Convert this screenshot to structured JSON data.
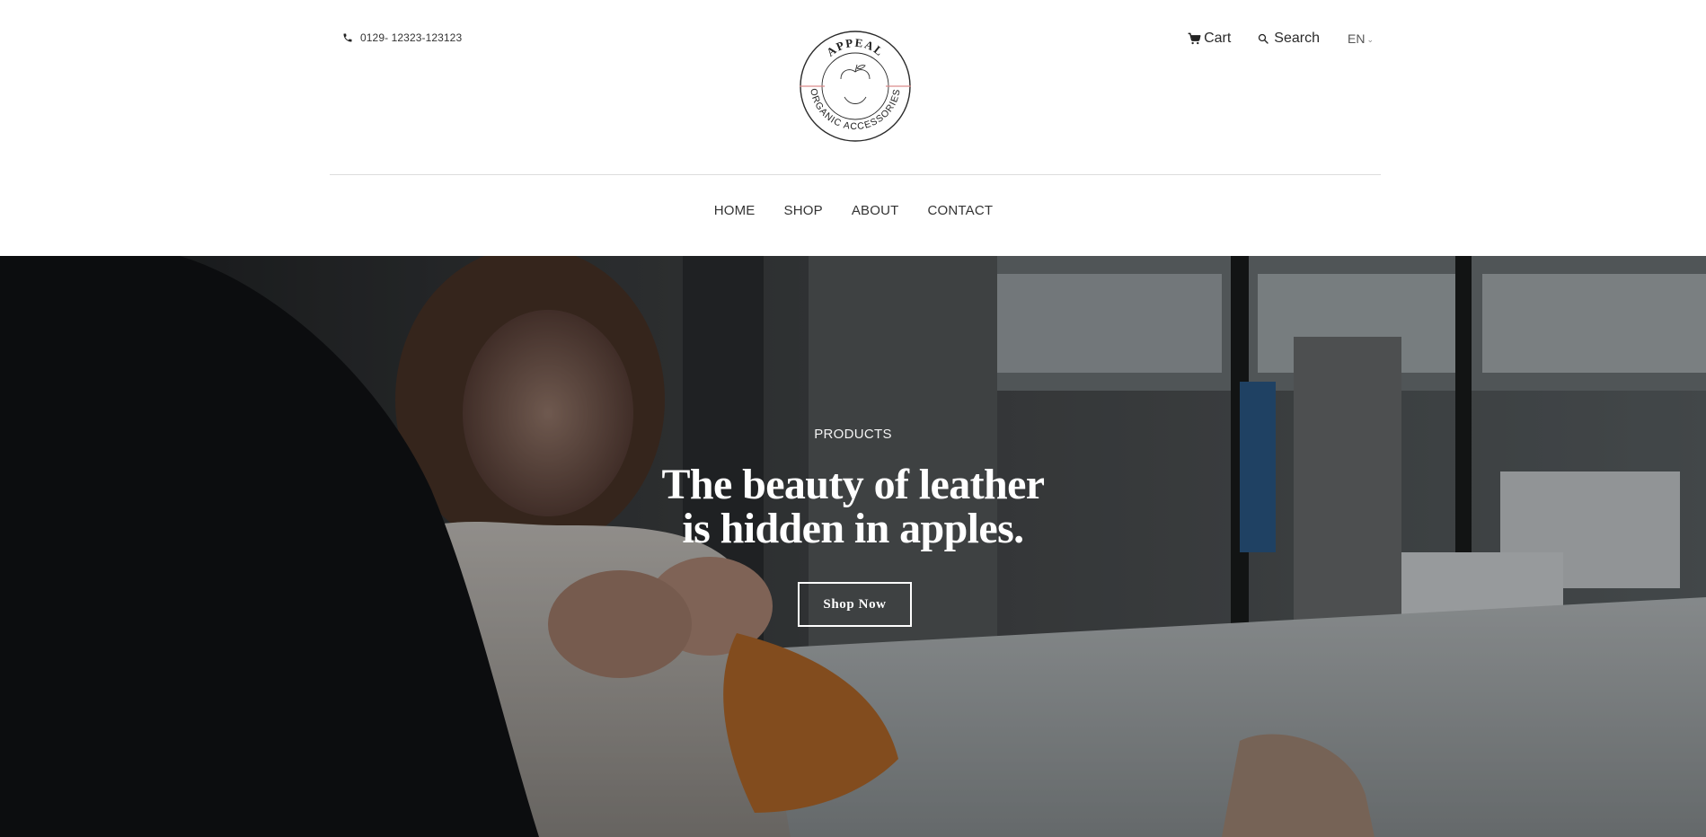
{
  "header": {
    "phone": {
      "icon": "phone-icon",
      "number": "0129- 12323-123123"
    },
    "logo": {
      "brand_top": "APPEAL",
      "brand_bottom": "ORGANIC ACCESSORIES",
      "icon": "apple-icon",
      "accent_color": "#d98c8c"
    },
    "utility": {
      "cart": {
        "icon": "cart-icon",
        "label": "Cart"
      },
      "search": {
        "icon": "search-icon",
        "label": "Search"
      },
      "language": {
        "label": "EN",
        "icon": "chevron-down-icon"
      }
    }
  },
  "nav": {
    "items": [
      {
        "label": "HOME"
      },
      {
        "label": "SHOP"
      },
      {
        "label": "ABOUT"
      },
      {
        "label": "CONTACT"
      }
    ]
  },
  "hero": {
    "eyebrow": "PRODUCTS",
    "headline_line1": "The beauty of leather",
    "headline_line2": "is hidden in apples.",
    "cta_label": "Shop Now"
  },
  "colors": {
    "text": "#222222",
    "divider": "#dcdcdc",
    "hero_text": "#ffffff"
  }
}
